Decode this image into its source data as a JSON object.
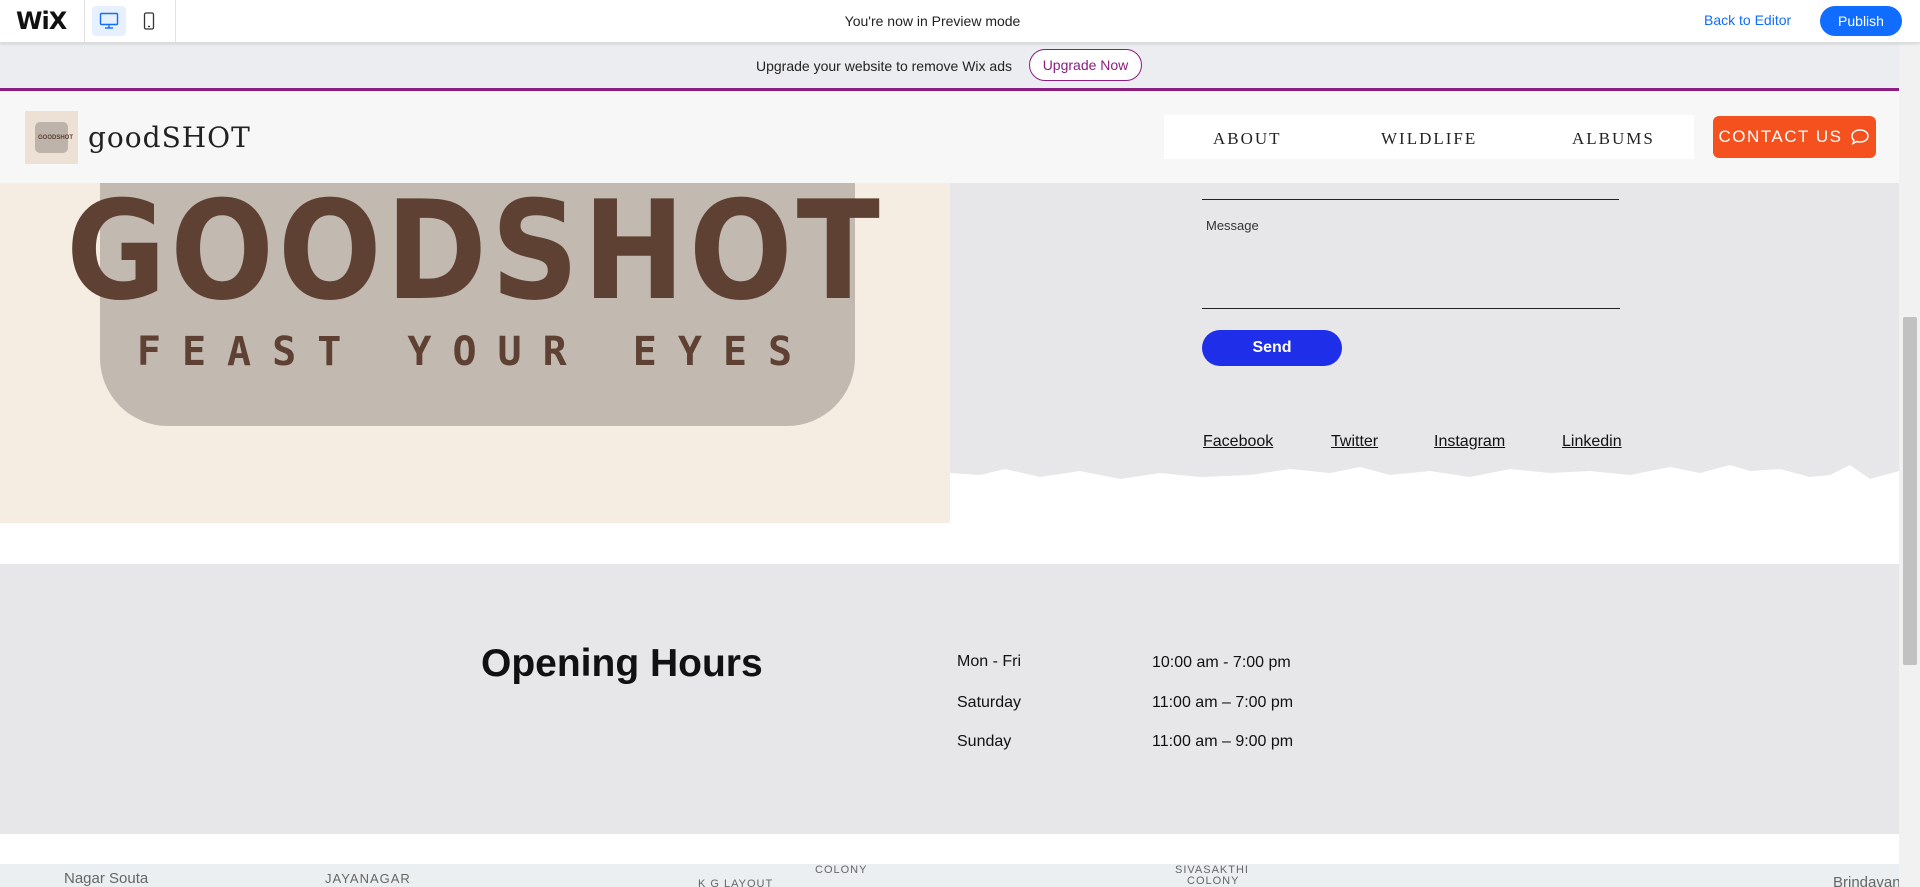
{
  "wix_bar": {
    "logo": "WiX",
    "preview_text": "You're now in Preview mode",
    "back_to_editor": "Back to Editor",
    "publish": "Publish",
    "accent": "#116dff"
  },
  "banner": {
    "text": "Upgrade your website to remove Wix ads",
    "button": "Upgrade Now",
    "accent": "#8b1c80"
  },
  "header": {
    "logo_mark_text": "GOODSHOT",
    "site_name": "goodSHOT",
    "nav": [
      "ABOUT",
      "WILDLIFE",
      "ALBUMS"
    ],
    "contact_button": "CONTACT US",
    "contact_color": "#f4511e"
  },
  "hero": {
    "brand_title": "GOODSHOT",
    "tagline": "FEAST YOUR EYES"
  },
  "form": {
    "message_label": "Message",
    "send_button": "Send",
    "send_color": "#1f2ee8"
  },
  "social_links": [
    "Facebook",
    "Twitter",
    "Instagram",
    "Linkedin"
  ],
  "opening_hours": {
    "title": "Opening Hours",
    "rows": [
      {
        "day": "Mon - Fri",
        "time": "10:00 am - 7:00 pm"
      },
      {
        "day": "Saturday",
        "time": "11:00 am – 7:00 pm"
      },
      {
        "day": "Sunday",
        "time": "11:00 am – 9:00 pm"
      }
    ]
  },
  "map": {
    "labels": [
      "Nagar Souta",
      "JAYANAGAR",
      "K G LAYOUT",
      "COLONY",
      "SIVASAKTHI",
      "COLONY",
      "Brindavan"
    ]
  }
}
